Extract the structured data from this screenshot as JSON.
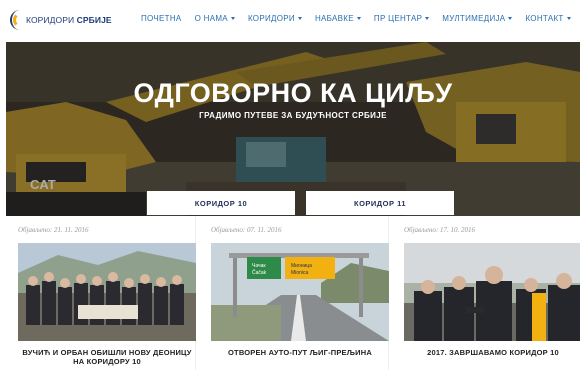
{
  "brand": {
    "name_light": "КОРИДОРИ",
    "name_bold": "СРБИЈЕ"
  },
  "menu": [
    {
      "label": "ПОЧЕТНА",
      "dropdown": false
    },
    {
      "label": "О НАМА",
      "dropdown": true
    },
    {
      "label": "КОРИДОРИ",
      "dropdown": true
    },
    {
      "label": "НАБАВКЕ",
      "dropdown": true
    },
    {
      "label": "ПР ЦЕНТАР",
      "dropdown": true
    },
    {
      "label": "МУЛТИМЕДИЈА",
      "dropdown": true
    },
    {
      "label": "КОНТАКТ",
      "dropdown": true
    }
  ],
  "hero": {
    "title": "ОДГОВОРНО КА ЦИЉУ",
    "subtitle": "ГРАДИМО ПУТЕВЕ ЗА БУДУЋНОСТ СРБИЈЕ",
    "buttons": [
      "КОРИДОР 10",
      "КОРИДОР 11"
    ],
    "machine_label": "CAT"
  },
  "news": [
    {
      "date": "Објављено: 21. 11. 2016",
      "title": "ВУЧИЋ И ОРБАН ОБИШЛИ НОВУ ДЕОНИЦУ НА КОРИДОРУ 10"
    },
    {
      "date": "Објављено: 07. 11. 2016",
      "title": "ОТВОРЕН АУТО-ПУТ ЉИГ-ПРЕЉИНА",
      "sign_left": [
        "Чачак",
        "Čačak"
      ],
      "sign_right": [
        "Мионица",
        "Mionica"
      ]
    },
    {
      "date": "Објављено: 17. 10. 2016",
      "title": "2017. ЗАВРШАВАМО КОРИДОР 10"
    }
  ],
  "colors": {
    "nav_link": "#2a6fb0",
    "brand_blue": "#1f3c7a",
    "brand_yellow": "#f2b011",
    "button_text": "#1f2f5a"
  }
}
